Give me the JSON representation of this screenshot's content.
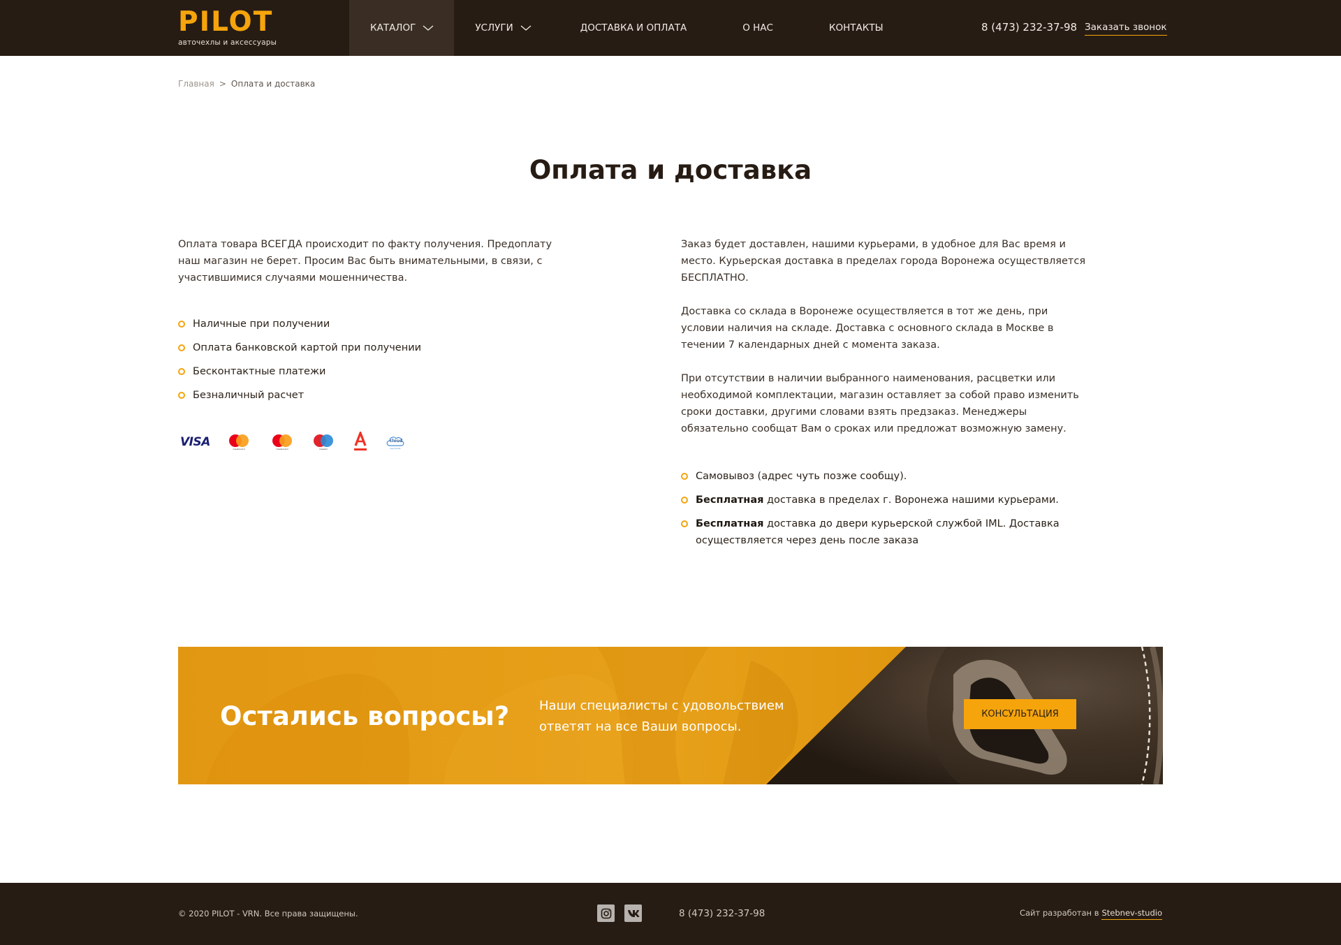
{
  "header": {
    "logo_text": "PILOT",
    "logo_sub": "авточехлы и аксессуары",
    "nav": [
      {
        "label": "КАТАЛОГ"
      },
      {
        "label": "УСЛУГИ"
      },
      {
        "label": "ДОСТАВКА И ОПЛАТА"
      },
      {
        "label": "О НАС"
      },
      {
        "label": "КОНТАКТЫ"
      }
    ],
    "phone": "8 (473) 232-37-98",
    "callback_label": "Заказать звонок"
  },
  "breadcrumb": {
    "home": "Главная",
    "separator": ">",
    "current": "Оплата и доставка"
  },
  "page_title": "Оплата и доставка",
  "payment": {
    "intro": "Оплата товара ВСЕГДА происходит по факту получения. Предоплату наш магазин не берет. Просим Вас быть внимательными, в связи, с участившимися случаями мошенничества.",
    "methods": [
      "Наличные при получении",
      "Оплата банковской картой при получении",
      "Бесконтактные платежи",
      "Безналичный расчет"
    ],
    "logos": {
      "visa": "VISA",
      "mastercard": "mastercard",
      "maestro": "maestro",
      "cloud": "cloud",
      "cloud_sub": "payments"
    }
  },
  "delivery": {
    "paragraphs": [
      "Заказ будет доставлен, нашими курьерами, в удобное для Вас время и место. Курьерская доставка в пределах города Воронежа осуществляется БЕСПЛАТНО.",
      "Доставка со склада в Воронеже осуществляется в тот же день, при условии наличия на складе. Доставка с основного склада в Москве в течении 7 календарных дней с момента заказа.",
      "При отсутствии в наличии выбранного наименования, расцветки или необходимой комплектации, магазин оставляет за собой право изменить сроки доставки, другими словами взять предзаказ. Менеджеры обязательно сообщат Вам о сроках или предложат возможную замену."
    ],
    "options": [
      {
        "bold": "",
        "text": "Самовывоз (адрес чуть позже сообщу)."
      },
      {
        "bold": "Бесплатная",
        "text": " доставка в пределах г. Воронежа нашими курьерами."
      },
      {
        "bold": "Бесплатная",
        "text": " доставка до двери курьерской службой IML. Доставка осуществляется через день после заказа"
      }
    ]
  },
  "banner": {
    "title": "Остались вопросы?",
    "text": "Наши специалисты с удовольствием ответят на все Ваши вопросы.",
    "button": "КОНСУЛЬТАЦИЯ"
  },
  "footer": {
    "copyright": "© 2020 PILOT - VRN. Все права защищены.",
    "phone": "8 (473) 232-37-98",
    "dev_prefix": "Сайт разработан в",
    "dev_link": "Stebnev-studio"
  },
  "colors": {
    "accent": "#f5a40c",
    "dark": "#271c14"
  }
}
